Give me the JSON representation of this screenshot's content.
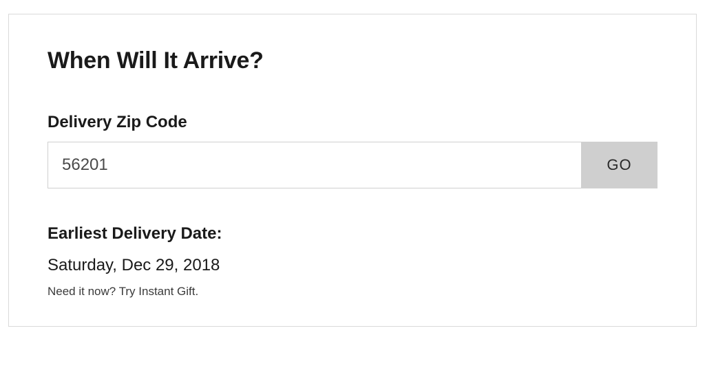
{
  "title": "When Will It Arrive?",
  "zip": {
    "label": "Delivery Zip Code",
    "value": "56201",
    "placeholder": "",
    "button": "GO"
  },
  "delivery": {
    "label": "Earliest Delivery Date:",
    "date": "Saturday, Dec 29, 2018",
    "hint": "Need it now? Try Instant Gift."
  }
}
